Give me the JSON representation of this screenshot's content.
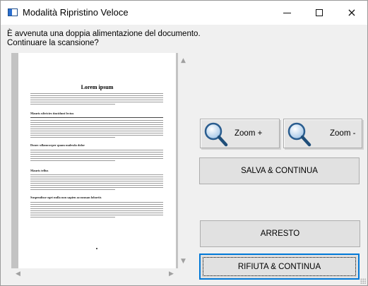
{
  "window": {
    "title": "Modalità Ripristino Veloce",
    "controls": {
      "minimize": "–",
      "maximize": "□",
      "close": "×"
    }
  },
  "message": {
    "line1": "È avvenuta una doppia alimentazione del documento.",
    "line2": "Continuare la scansione?"
  },
  "preview": {
    "document_title": "Lorem ipsum",
    "headings": [
      "Mauris ultricies tincidunt lectus",
      "Donec ullamcorper quam malesda dolor",
      "Mauris tellus",
      "Suspendisse eget nulla non sapien accumsan lobortis"
    ]
  },
  "buttons": {
    "zoom_in": "Zoom +",
    "zoom_out": "Zoom -",
    "save_continue": "SALVA & CONTINUA",
    "stop": "ARRESTO",
    "reject_continue": "RIFIUTA & CONTINUA"
  },
  "icons": {
    "zoom_in": "magnifier-icon",
    "zoom_out": "magnifier-icon",
    "app": "scanner-app-icon"
  },
  "colors": {
    "focus_border": "#0078d7",
    "window_background": "#f0f0f0",
    "preview_background": "#c3c3c3"
  }
}
